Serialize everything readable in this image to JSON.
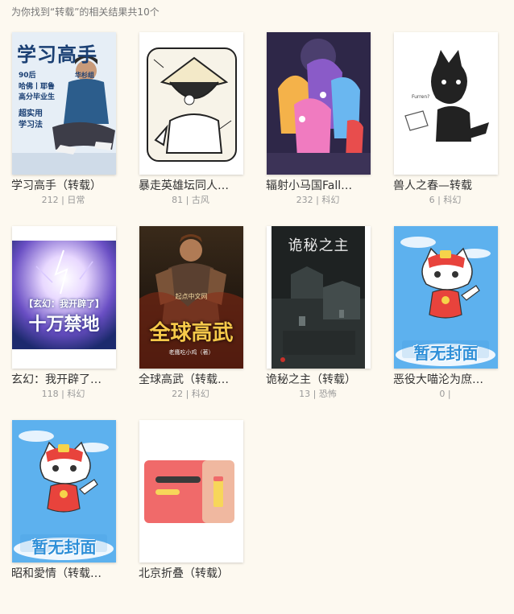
{
  "search": {
    "summary": "为你找到“转载”的相关结果共10个"
  },
  "books": [
    {
      "title": "学习高手（转载）",
      "reads": "212",
      "sep": " | ",
      "category": "日常",
      "cover_text": {
        "title": "学习高手",
        "line1": "90后",
        "line2": "哈佛丨耶鲁",
        "line3": "高分毕业生",
        "line4": "超实用",
        "line5": "学习法",
        "author": "华杉组"
      }
    },
    {
      "title": "暴走英雄坛同人…",
      "reads": "81",
      "sep": " | ",
      "category": "古风"
    },
    {
      "title": "辐射小马国Fall…",
      "reads": "232",
      "sep": " | ",
      "category": "科幻"
    },
    {
      "title": "兽人之春—转载",
      "reads": "6",
      "sep": " | ",
      "category": "科幻",
      "cover_text": {
        "sign": "Furren?"
      }
    },
    {
      "title": "玄幻：我开辟了…",
      "reads": "118",
      "sep": " | ",
      "category": "科幻",
      "cover_text": {
        "line1": "【玄幻：我开辟了】",
        "line2": "十万禁地"
      }
    },
    {
      "title": "全球高武（转载…",
      "reads": "22",
      "sep": " | ",
      "category": "科幻",
      "cover_text": {
        "title": "全球高武",
        "publisher": "起点中文网",
        "author": "老鹰吃小鸡（著）"
      }
    },
    {
      "title": "诡秘之主（转载）",
      "reads": "13",
      "sep": " | ",
      "category": "恐怖",
      "cover_text": {
        "title": "诡秘之主"
      }
    },
    {
      "title": "恶役大喵沦为庶…",
      "reads": "0",
      "sep": " | ",
      "category": "",
      "cover_text": {
        "placeholder": "暂无封面"
      }
    },
    {
      "title": "昭和愛情（转载…",
      "reads": "",
      "sep": "",
      "category": "",
      "cover_text": {
        "placeholder": "暂无封面"
      }
    },
    {
      "title": "北京折叠（转载）",
      "reads": "",
      "sep": "",
      "category": ""
    }
  ],
  "colors": {
    "background": "#fdf9f0",
    "title_text": "#333333",
    "meta_text": "#999999",
    "placeholder_sky": "#4aa3e8",
    "placeholder_cat_red": "#e8433c",
    "placeholder_banner": "#2e8fd8"
  }
}
